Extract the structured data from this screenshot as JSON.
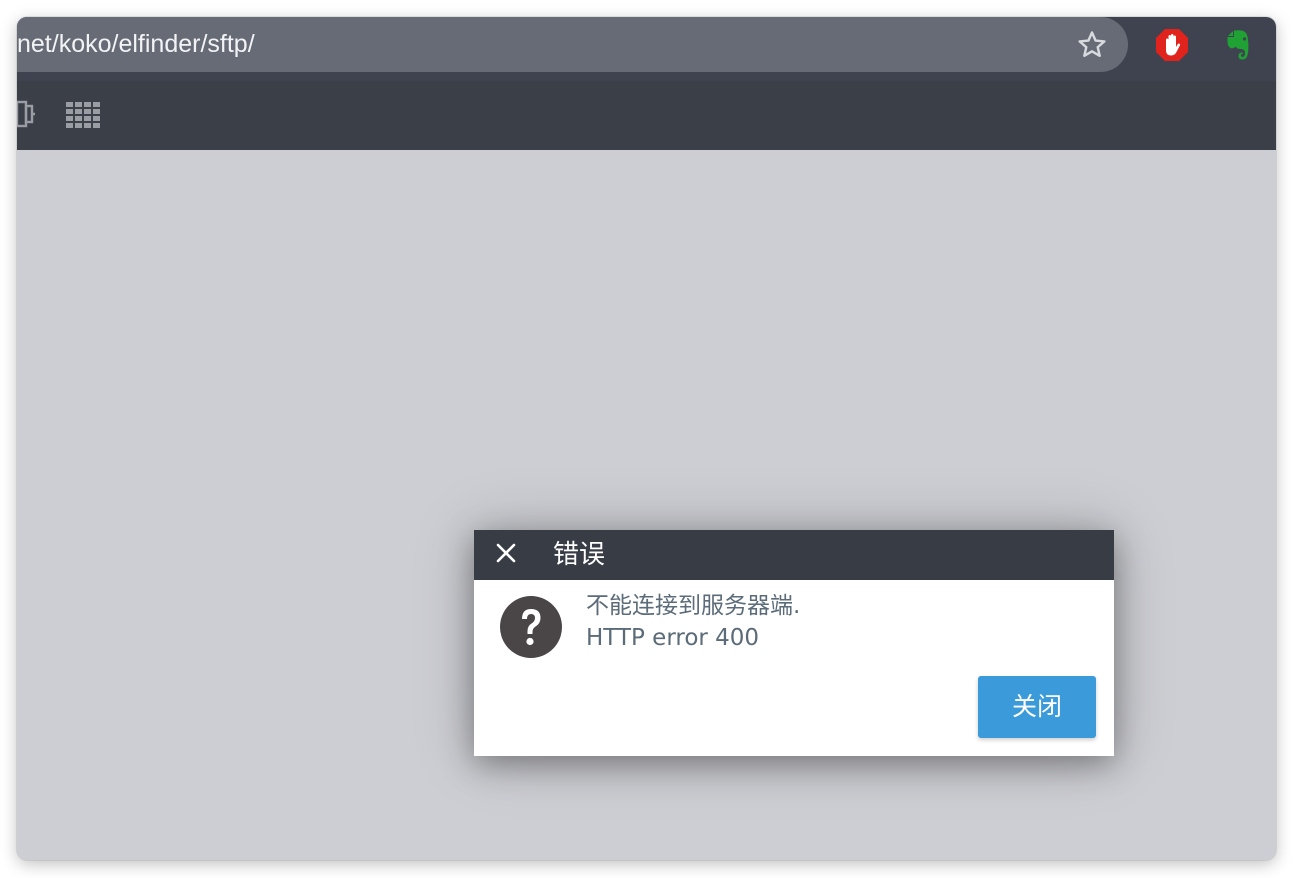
{
  "browser": {
    "url": "net/koko/elfinder/sftp/",
    "icons": {
      "bookmark": "star-icon",
      "extension_1": "adblock-icon",
      "extension_2": "evernote-icon"
    }
  },
  "toolbar": {
    "icons": [
      "partial-icon",
      "grid-view-icon"
    ]
  },
  "dialog": {
    "title": "错误",
    "close_icon": "close-icon",
    "status_icon": "question-icon",
    "message_line1": "不能连接到服务器端.",
    "message_line2": "HTTP error 400",
    "close_button_label": "关闭"
  },
  "colors": {
    "titlebar": "#383c45",
    "toolbar": "#3b3f48",
    "workspace": "#cdced3",
    "button": "#3b9ad9",
    "message_text": "#5b6b78",
    "adblock_red": "#e0231c",
    "evernote_green": "#1fa134"
  }
}
